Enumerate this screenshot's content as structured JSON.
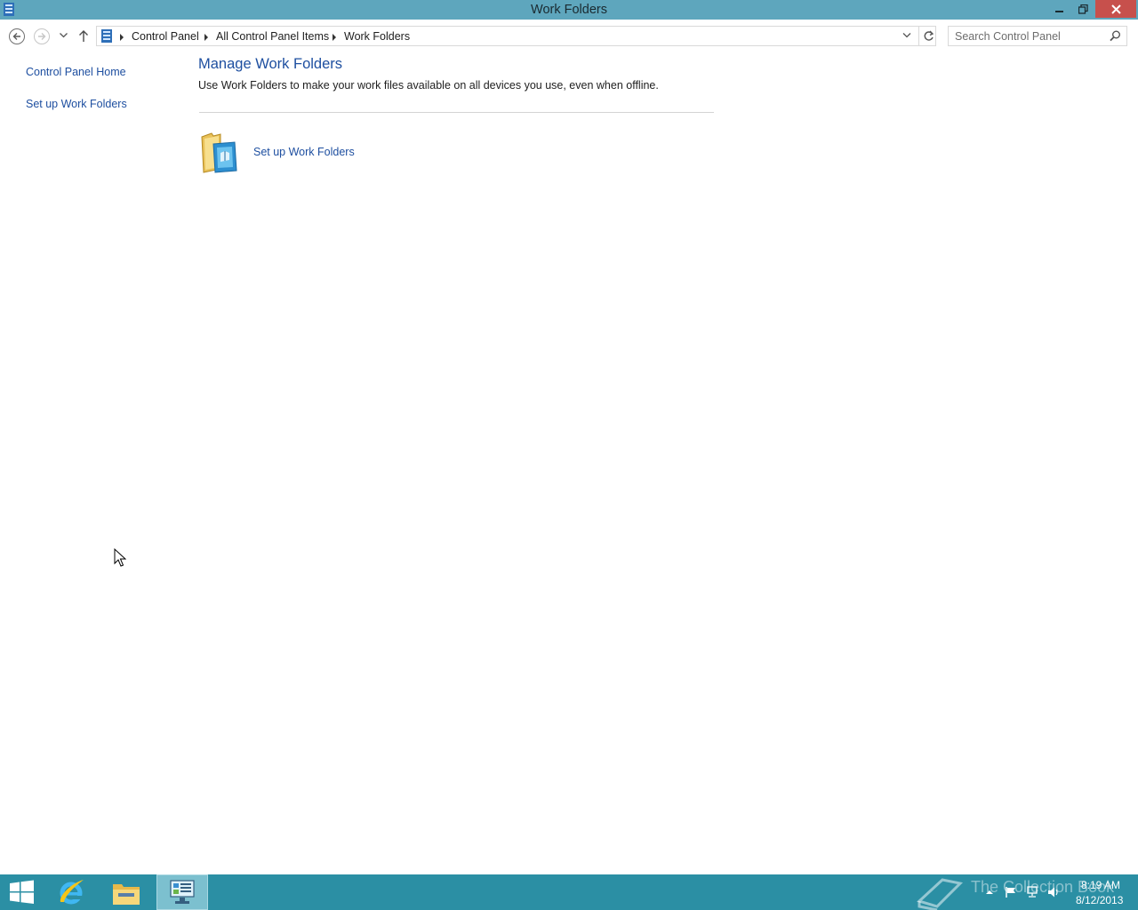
{
  "window": {
    "title": "Work Folders",
    "colors": {
      "titlebar": "#5ea6bd",
      "close_button": "#c7504c",
      "link": "#1e4fa0",
      "taskbar": "#2b8fa4"
    }
  },
  "navigation": {
    "breadcrumbs": [
      "Control Panel",
      "All Control Panel Items",
      "Work Folders"
    ],
    "search_placeholder": "Search Control Panel"
  },
  "left_pane": {
    "links": [
      "Control Panel Home",
      "Set up Work Folders"
    ]
  },
  "main": {
    "heading": "Manage Work Folders",
    "description": "Use Work Folders to make your work files available on all devices you use, even when offline.",
    "task_link": "Set up Work Folders"
  },
  "taskbar": {
    "watermark": "The Collection Book",
    "clock_time": "8:19 AM",
    "clock_date": "8/12/2013"
  }
}
